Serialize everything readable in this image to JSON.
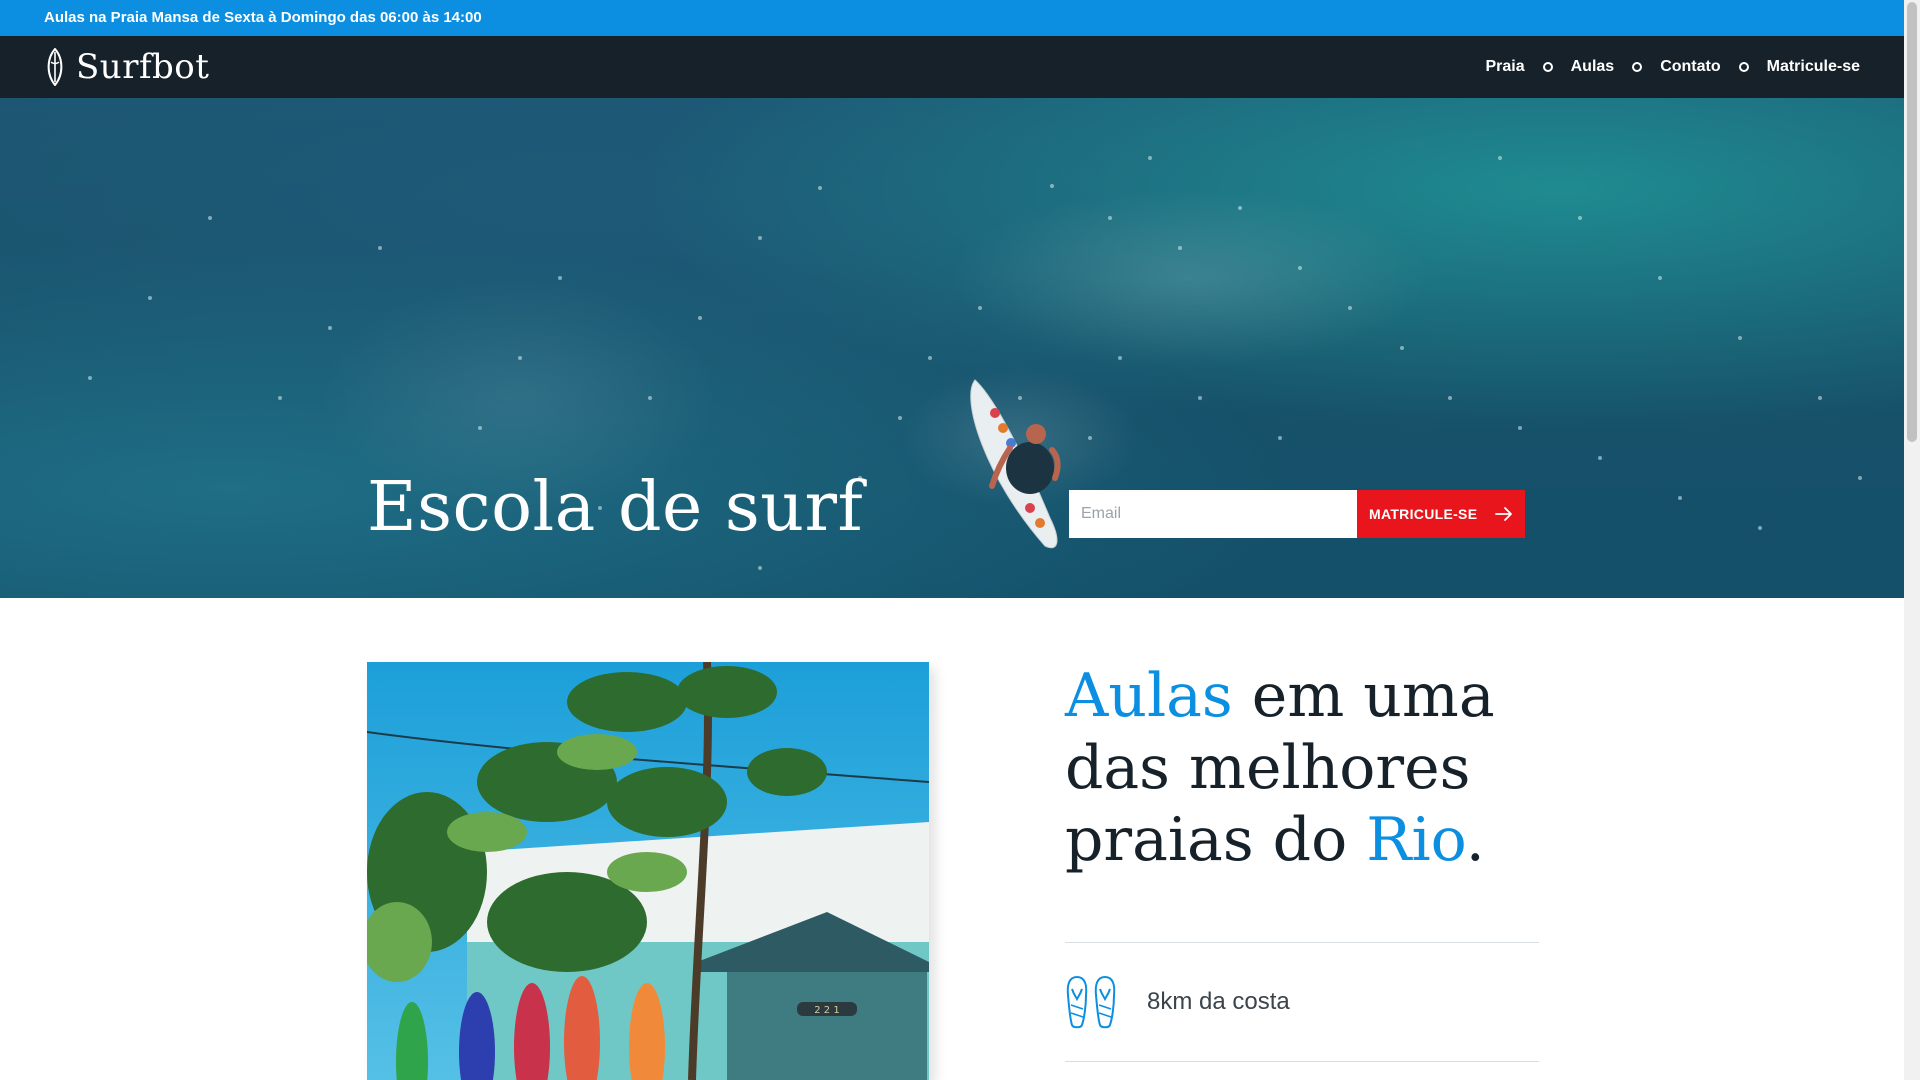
{
  "announcement": "Aulas na Praia Mansa de Sexta à Domingo das 06:00 às 14:00",
  "brand": {
    "name": "Surfbot",
    "logo_icon": "surfboard-icon"
  },
  "nav": {
    "items": [
      {
        "label": "Praia"
      },
      {
        "label": "Aulas"
      },
      {
        "label": "Contato"
      },
      {
        "label": "Matricule-se"
      }
    ],
    "separator_icon": "circle-icon"
  },
  "hero": {
    "title": "Escola de surf",
    "email_placeholder": "Email",
    "email_value": "",
    "cta_label": "MATRICULE-SE",
    "cta_icon": "arrow-right-icon"
  },
  "intro": {
    "headline": {
      "accent1": "Aulas",
      "text1": " em uma das melhores praias do ",
      "accent2": "Rio",
      "text2": "."
    },
    "features": [
      {
        "icon": "flip-flops-icon",
        "text": "8km da costa"
      }
    ]
  },
  "colors": {
    "accent": "#0c8fe0",
    "nav_bg": "#16212a",
    "cta": "#e8151d"
  }
}
